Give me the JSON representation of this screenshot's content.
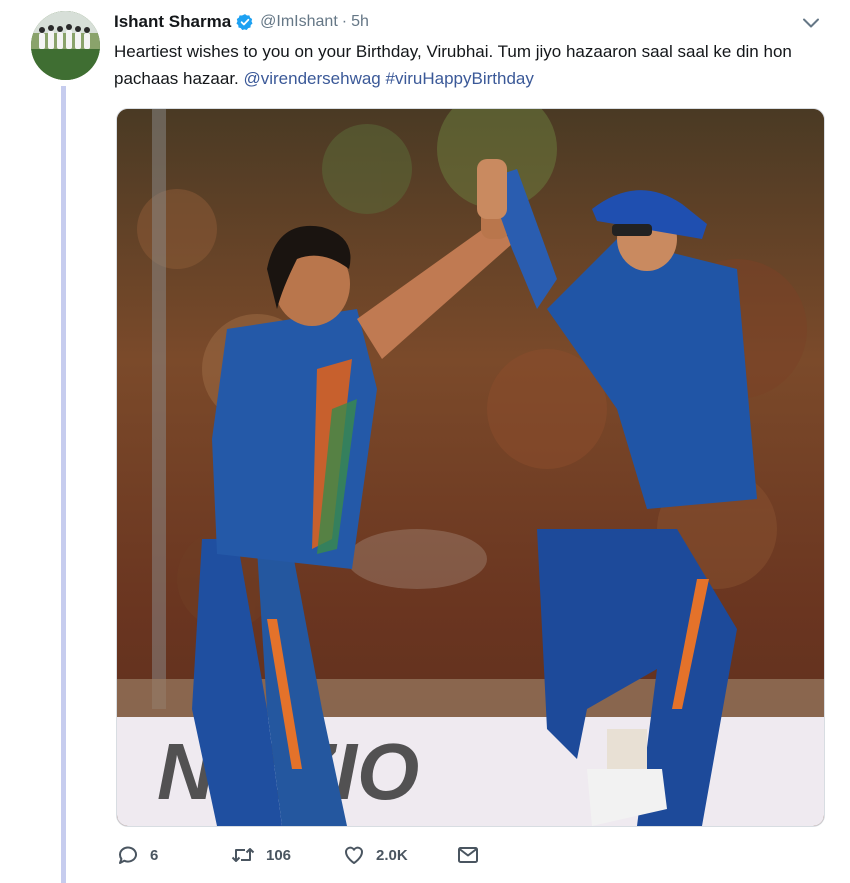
{
  "tweet": {
    "author_name": "Ishant Sharma",
    "handle": "@ImIshant",
    "separator": "·",
    "time": "5h",
    "text_main": "Heartiest wishes to you on your Birthday, Virubhai. Tum jiyo hazaaron saal saal ke din hon pachaas hazaar. ",
    "mention": "@virendersehwag",
    "hashtag": "#viruHappyBirthday",
    "verified": true,
    "media_banner_text": "NIZZIO"
  },
  "actions": {
    "replies": "6",
    "retweets": "106",
    "likes": "2.0K"
  },
  "icons": {
    "verified": "verified-badge-icon",
    "caret": "chevron-down-icon",
    "reply": "reply-icon",
    "retweet": "retweet-icon",
    "like": "heart-icon",
    "dm": "envelope-icon"
  },
  "colors": {
    "thread_line": "#c6ccee",
    "link": "#3b5998",
    "verified": "#1da1f2",
    "muted": "#657786"
  }
}
